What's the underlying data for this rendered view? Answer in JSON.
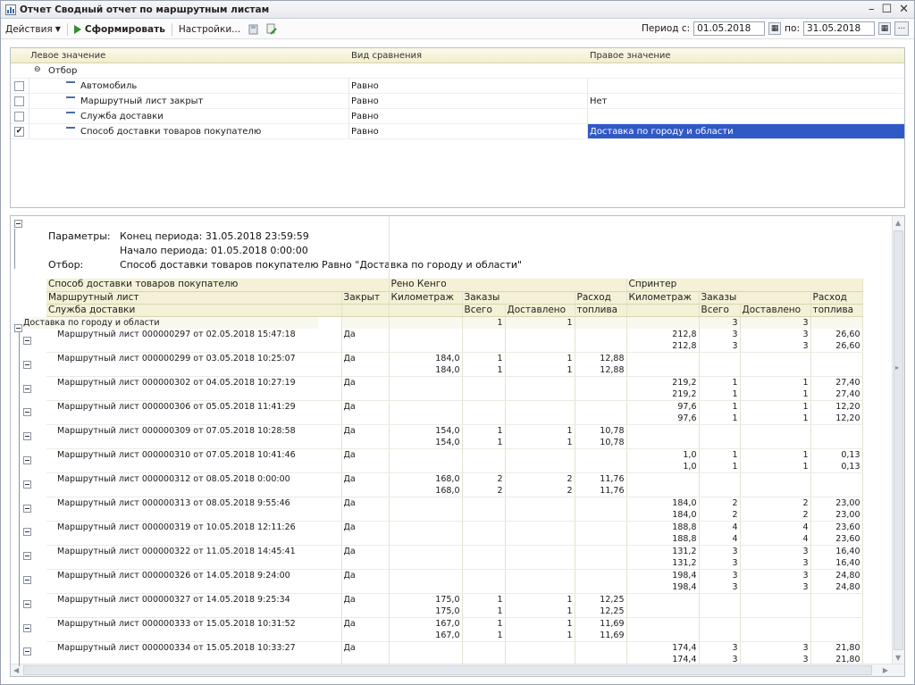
{
  "window": {
    "title": "Отчет  Сводный отчет по маршрутным листам"
  },
  "toolbar": {
    "actions": "Действия",
    "generate": "Сформировать",
    "settings": "Настройки...",
    "period_from_label": "Период с:",
    "period_from": "01.05.2018",
    "period_to_label": "по:",
    "period_to": "31.05.2018",
    "ellipsis": "..."
  },
  "filter": {
    "columns": [
      "Левое значение",
      "Вид сравнения",
      "Правое значение"
    ],
    "group_label": "Отбор",
    "rows": [
      {
        "left": "Автомобиль",
        "op": "Равно",
        "right": "",
        "checked": false
      },
      {
        "left": "Маршрутный лист закрыт",
        "op": "Равно",
        "right": "Нет",
        "checked": false
      },
      {
        "left": "Служба доставки",
        "op": "Равно",
        "right": "",
        "checked": false
      },
      {
        "left": "Способ доставки товаров покупателю",
        "op": "Равно",
        "right": "Доставка по городу и области",
        "checked": true
      }
    ]
  },
  "report": {
    "params_label": "Параметры:",
    "period_end": "Конец периода: 31.05.2018 23:59:59",
    "period_start": "Начало периода: 01.05.2018 0:00:00",
    "filter_label": "Отбор:",
    "filter_text": "Способ доставки товаров покупателю Равно \"Доставка по городу и области\"",
    "header": {
      "row1": [
        "Способ доставки товаров покупателю",
        "Рено Кенго",
        "Спринтер"
      ],
      "row2": [
        "Маршрутный лист",
        "Закрыт",
        "Километраж",
        "Заказы",
        "Расход",
        "Километраж",
        "Заказы",
        "Расход"
      ],
      "row3": [
        "Служба доставки",
        "Всего",
        "Доставлено",
        "топлива",
        "Всего",
        "Доставлено",
        "топлива"
      ]
    },
    "group_row": {
      "name": "Доставка по городу и области",
      "reno_total": "1",
      "reno_delivered": "1",
      "spr_total": "3",
      "spr_delivered": "3"
    },
    "sheets": [
      {
        "name": "Маршрутный лист 000000297 от 02.05.2018 15:47:18",
        "closed": "Да",
        "reno": [
          "",
          "",
          "",
          ""
        ],
        "spr": [
          "212,8",
          "3",
          "3",
          "26,60"
        ]
      },
      {
        "name": "Маршрутный лист 000000299 от 03.05.2018 10:25:07",
        "closed": "Да",
        "reno": [
          "184,0",
          "1",
          "1",
          "12,88"
        ],
        "spr": [
          "",
          "",
          "",
          ""
        ]
      },
      {
        "name": "Маршрутный лист 000000302 от 04.05.2018 10:27:19",
        "closed": "Да",
        "reno": [
          "",
          "",
          "",
          ""
        ],
        "spr": [
          "219,2",
          "1",
          "1",
          "27,40"
        ]
      },
      {
        "name": "Маршрутный лист 000000306 от 05.05.2018 11:41:29",
        "closed": "Да",
        "reno": [
          "",
          "",
          "",
          ""
        ],
        "spr": [
          "97,6",
          "1",
          "1",
          "12,20"
        ]
      },
      {
        "name": "Маршрутный лист 000000309 от 07.05.2018 10:28:58",
        "closed": "Да",
        "reno": [
          "154,0",
          "1",
          "1",
          "10,78"
        ],
        "spr": [
          "",
          "",
          "",
          ""
        ]
      },
      {
        "name": "Маршрутный лист 000000310 от 07.05.2018 10:41:46",
        "closed": "Да",
        "reno": [
          "",
          "",
          "",
          ""
        ],
        "spr": [
          "1,0",
          "1",
          "1",
          "0,13"
        ]
      },
      {
        "name": "Маршрутный лист 000000312 от 08.05.2018 0:00:00",
        "closed": "Да",
        "reno": [
          "168,0",
          "2",
          "2",
          "11,76"
        ],
        "spr": [
          "",
          "",
          "",
          ""
        ]
      },
      {
        "name": "Маршрутный лист 000000313 от 08.05.2018 9:55:46",
        "closed": "Да",
        "reno": [
          "",
          "",
          "",
          ""
        ],
        "spr": [
          "184,0",
          "2",
          "2",
          "23,00"
        ]
      },
      {
        "name": "Маршрутный лист 000000319 от 10.05.2018 12:11:26",
        "closed": "Да",
        "reno": [
          "",
          "",
          "",
          ""
        ],
        "spr": [
          "188,8",
          "4",
          "4",
          "23,60"
        ]
      },
      {
        "name": "Маршрутный лист 000000322 от 11.05.2018 14:45:41",
        "closed": "Да",
        "reno": [
          "",
          "",
          "",
          ""
        ],
        "spr": [
          "131,2",
          "3",
          "3",
          "16,40"
        ]
      },
      {
        "name": "Маршрутный лист 000000326 от 14.05.2018 9:24:00",
        "closed": "Да",
        "reno": [
          "",
          "",
          "",
          ""
        ],
        "spr": [
          "198,4",
          "3",
          "3",
          "24,80"
        ]
      },
      {
        "name": "Маршрутный лист 000000327 от 14.05.2018 9:25:34",
        "closed": "Да",
        "reno": [
          "175,0",
          "1",
          "1",
          "12,25"
        ],
        "spr": [
          "",
          "",
          "",
          ""
        ]
      },
      {
        "name": "Маршрутный лист 000000333 от 15.05.2018 10:31:52",
        "closed": "Да",
        "reno": [
          "167,0",
          "1",
          "1",
          "11,69"
        ],
        "spr": [
          "",
          "",
          "",
          ""
        ]
      },
      {
        "name": "Маршрутный лист 000000334 от 15.05.2018 10:33:27",
        "closed": "Да",
        "reno": [
          "",
          "",
          "",
          ""
        ],
        "spr": [
          "174,4",
          "3",
          "3",
          "21,80"
        ]
      }
    ]
  }
}
